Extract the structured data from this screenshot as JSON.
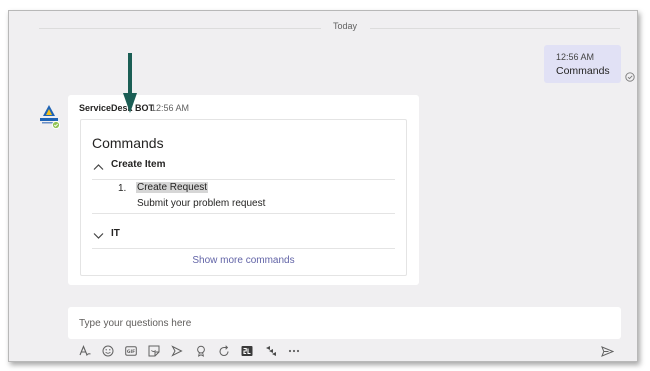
{
  "chat": {
    "date_divider": "Today",
    "outgoing": {
      "time": "12:56 AM",
      "text": "Commands"
    }
  },
  "bot_message": {
    "sender": "ServiceDesk BOT",
    "time": "12:56 AM",
    "card": {
      "title": "Commands",
      "sections": [
        {
          "label": "Create Item",
          "expanded": true
        },
        {
          "label": "IT",
          "expanded": false
        }
      ],
      "items": [
        {
          "number": "1.",
          "title": "Create Request",
          "description": "Submit your problem request"
        }
      ],
      "show_more": "Show more commands"
    }
  },
  "composer": {
    "placeholder": "Type your questions here",
    "toolbar_icons": [
      "format-icon",
      "emoji-icon",
      "gif-icon",
      "sticker-icon",
      "meet-now-icon",
      "praise-icon",
      "loop-icon",
      "app-icon",
      "stream-icon",
      "more-options-icon"
    ],
    "send_icon": "send-icon"
  },
  "colors": {
    "frame_background": "#f0eff1",
    "outgoing_bubble": "#e1e1f5",
    "accent": "#6264a7",
    "annotation_arrow": "#1b5e55"
  }
}
